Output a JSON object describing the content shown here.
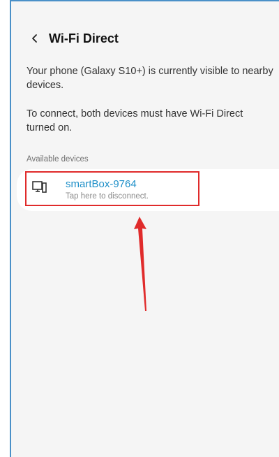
{
  "header": {
    "back_icon": "chevron-left-icon",
    "title": "Wi-Fi Direct"
  },
  "description": {
    "visibility": "Your phone (Galaxy S10+) is currently visible to nearby devices.",
    "instructions": "To connect, both devices must have Wi-Fi Direct turned on."
  },
  "available_devices": {
    "label": "Available devices",
    "items": [
      {
        "icon": "monitor-icon",
        "name": "smartBox-9764",
        "status": "Tap here to disconnect."
      }
    ]
  },
  "colors": {
    "device_name": "#1e8fc8",
    "highlight_box": "#e02b2b",
    "annotation_arrow": "#e02b2b",
    "background": "#f5f5f5"
  }
}
